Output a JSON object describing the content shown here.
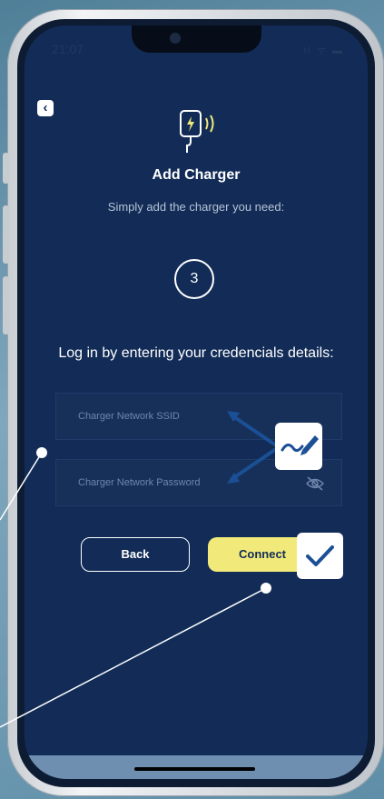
{
  "status_bar": {
    "time": "21:07",
    "icons": "ıl ᯤ ▬"
  },
  "header": {
    "back_icon": "chevron-left-icon",
    "title": "Add Charger",
    "subtitle": "Simply add the charger you need:"
  },
  "step": {
    "number": "3"
  },
  "instruction": "Log in by entering your credencials details:",
  "form": {
    "ssid_placeholder": "Charger Network SSID",
    "password_placeholder": "Charger Network Password"
  },
  "buttons": {
    "back_label": "Back",
    "connect_label": "Connect"
  },
  "colors": {
    "background": "#122c57",
    "accent": "#f1ea7a",
    "callout_arrow": "#1b4f96",
    "text": "#ffffff"
  }
}
